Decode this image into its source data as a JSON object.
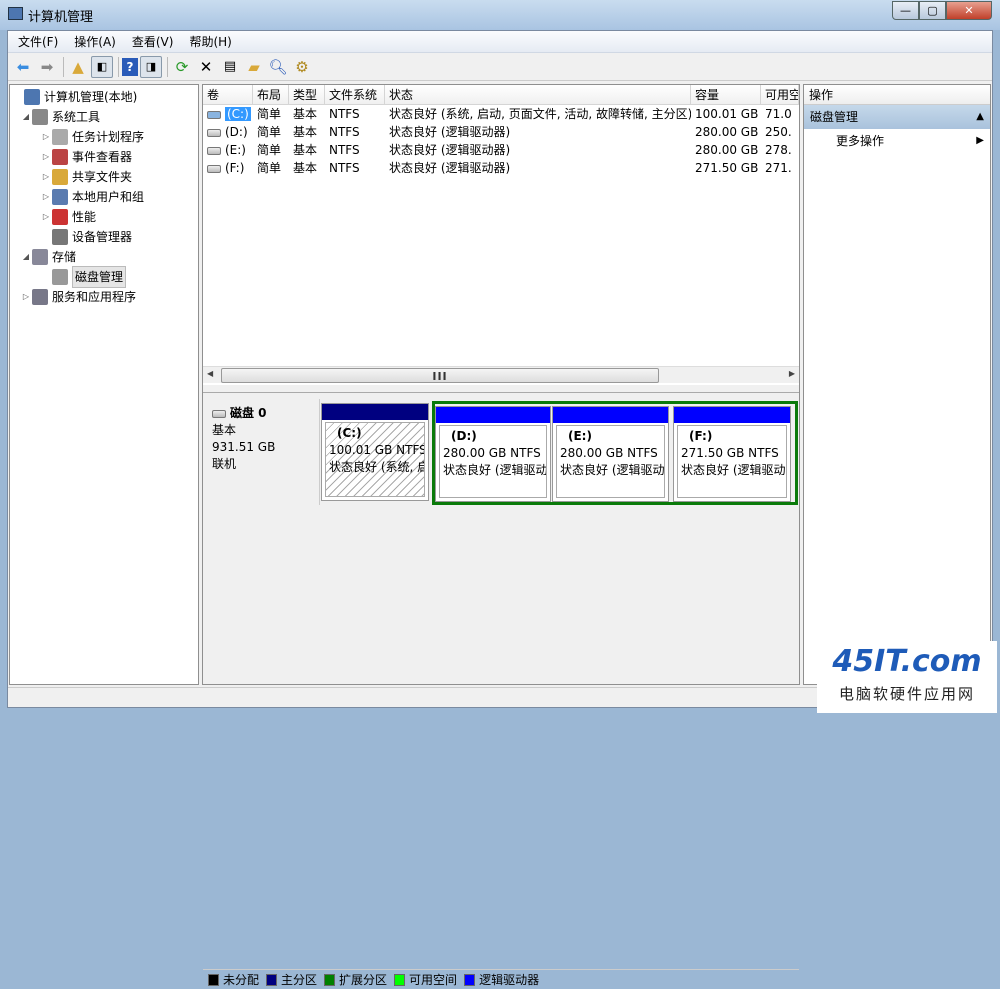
{
  "window": {
    "title": "计算机管理",
    "min": "—",
    "max": "▢",
    "close": "✕"
  },
  "menu": [
    "文件(F)",
    "操作(A)",
    "查看(V)",
    "帮助(H)"
  ],
  "tree": [
    {
      "label": "计算机管理(本地)",
      "level": 0,
      "exp": "",
      "color": "#4d76b0"
    },
    {
      "label": "系统工具",
      "level": 1,
      "exp": "◢",
      "color": "#888"
    },
    {
      "label": "任务计划程序",
      "level": 2,
      "exp": "▷",
      "color": "#aaa"
    },
    {
      "label": "事件查看器",
      "level": 2,
      "exp": "▷",
      "color": "#b44"
    },
    {
      "label": "共享文件夹",
      "level": 2,
      "exp": "▷",
      "color": "#d9a93a"
    },
    {
      "label": "本地用户和组",
      "level": 2,
      "exp": "▷",
      "color": "#5a7bb0"
    },
    {
      "label": "性能",
      "level": 2,
      "exp": "▷",
      "color": "#c33"
    },
    {
      "label": "设备管理器",
      "level": 2,
      "exp": "",
      "color": "#777"
    },
    {
      "label": "存储",
      "level": 1,
      "exp": "◢",
      "color": "#889"
    },
    {
      "label": "磁盘管理",
      "level": 2,
      "exp": "",
      "color": "#999",
      "selected": true
    },
    {
      "label": "服务和应用程序",
      "level": 1,
      "exp": "▷",
      "color": "#778"
    }
  ],
  "volumes": {
    "headers": [
      "卷",
      "布局",
      "类型",
      "文件系统",
      "状态",
      "容量",
      "可用空"
    ],
    "rows": [
      [
        "(C:)",
        "简单",
        "基本",
        "NTFS",
        "状态良好 (系统, 启动, 页面文件, 活动, 故障转储, 主分区)",
        "100.01 GB",
        "71.0"
      ],
      [
        "(D:)",
        "简单",
        "基本",
        "NTFS",
        "状态良好 (逻辑驱动器)",
        "280.00 GB",
        "250."
      ],
      [
        "(E:)",
        "简单",
        "基本",
        "NTFS",
        "状态良好 (逻辑驱动器)",
        "280.00 GB",
        "278."
      ],
      [
        "(F:)",
        "简单",
        "基本",
        "NTFS",
        "状态良好 (逻辑驱动器)",
        "271.50 GB",
        "271."
      ]
    ],
    "scroll_grip": "III"
  },
  "disk": {
    "name": "磁盘 0",
    "type": "基本",
    "size": "931.51 GB",
    "status": "联机",
    "partitions": [
      {
        "label": "(C:)",
        "size": "100.01 GB NTFS",
        "status": "状态良好 (系统, 启",
        "bar": "#000080"
      },
      {
        "label": "(D:)",
        "size": "280.00 GB NTFS",
        "status": "状态良好 (逻辑驱动",
        "bar": "#0000ff"
      },
      {
        "label": "(E:)",
        "size": "280.00 GB NTFS",
        "status": "状态良好 (逻辑驱动",
        "bar": "#0000ff"
      },
      {
        "label": "(F:)",
        "size": "271.50 GB NTFS",
        "status": "状态良好 (逻辑驱动",
        "bar": "#0000ff"
      }
    ]
  },
  "legend": [
    {
      "label": "未分配",
      "color": "#000000"
    },
    {
      "label": "主分区",
      "color": "#000080"
    },
    {
      "label": "扩展分区",
      "color": "#008000"
    },
    {
      "label": "可用空间",
      "color": "#00ff00"
    },
    {
      "label": "逻辑驱动器",
      "color": "#0000ff"
    }
  ],
  "actions": {
    "header": "操作",
    "section": "磁盘管理",
    "item": "更多操作"
  },
  "watermark": {
    "logo": "45IT.com",
    "tagline": "电脑软硬件应用网"
  }
}
